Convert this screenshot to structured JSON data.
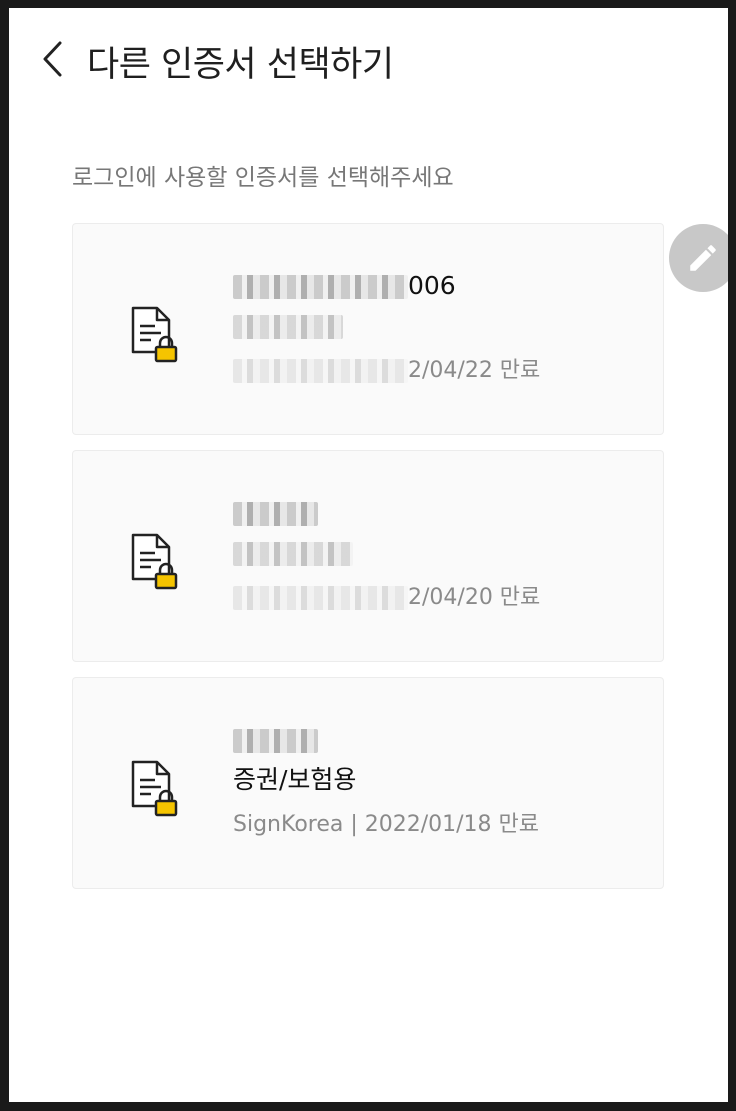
{
  "header": {
    "title": "다른 인증서 선택하기",
    "back_icon": "chevron-left-icon"
  },
  "instruction": "로그인에 사용할 인증서를 선택해주세요",
  "edit_icon": "pencil-icon",
  "certificates": [
    {
      "name": "006",
      "purpose": "",
      "meta": "2/04/22 만료"
    },
    {
      "name": "",
      "purpose": "",
      "meta": "2/04/20 만료"
    },
    {
      "name": "",
      "purpose": "증권/보험용",
      "meta": "SignKorea | 2022/01/18 만료"
    }
  ],
  "colors": {
    "lock_yellow": "#f5c400",
    "icon_stroke": "#222222",
    "fab_gray": "#c8c8c8"
  }
}
